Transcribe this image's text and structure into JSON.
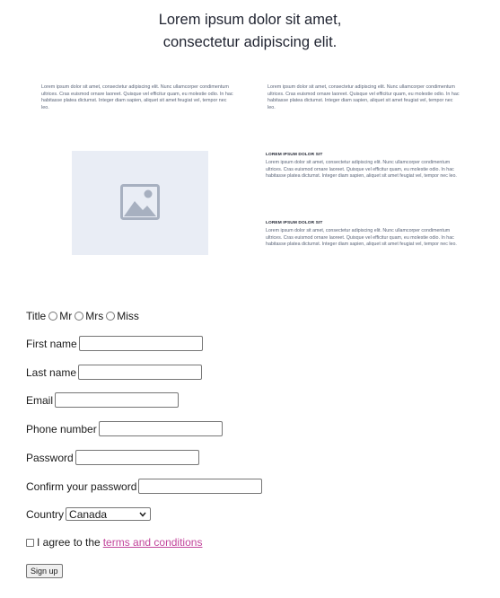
{
  "hero": {
    "headline_line1": "Lorem ipsum dolor sit amet,",
    "headline_line2": "consectetur adipiscing elit."
  },
  "content": {
    "para_left": "Lorem ipsum dolor sit amet, consectetur adipiscing elit. Nunc ullamcorper condimentum ultrices. Cras euismod ornare laoreet. Quisque vel efficitur quam, eu molestie odio. In hac habitasse platea dictumst. Integer diam sapien, aliquet sit amet feugiat vel, tempor nec leo.",
    "para_right": "Lorem ipsum dolor sit amet, consectetur adipiscing elit. Nunc ullamcorper condimentum ultrices. Cras euismod ornare laoreet. Quisque vel efficitur quam, eu molestie odio. In hac habitasse platea dictumst. Integer diam sapien, aliquet sit amet feugiat vel, tempor nec leo.",
    "image_icon": "image-placeholder-icon",
    "features": [
      {
        "title": "LOREM IPSUM DOLOR SIT",
        "text": "Lorem ipsum dolor sit amet, consectetur adipiscing elit. Nunc ullamcorper condimentum ultrices. Cras euismod ornare laoreet. Quisque vel efficitur quam, eu molestie odio. In hac habitasse platea dictumst. Integer diam sapien, aliquet sit amet feugiat vel, tempor nec leo."
      },
      {
        "title": "LOREM IPSUM DOLOR SIT",
        "text": "Lorem ipsum dolor sit amet, consectetur adipiscing elit. Nunc ullamcorper condimentum ultrices. Cras euismod ornare laoreet. Quisque vel efficitur quam, eu molestie odio. In hac habitasse platea dictumst. Integer diam sapien, aliquet sit amet feugiat vel, tempor nec leo."
      }
    ]
  },
  "form": {
    "title_label": "Title",
    "title_options": [
      "Mr",
      "Mrs",
      "Miss"
    ],
    "first_name_label": "First name",
    "first_name_value": "",
    "last_name_label": "Last name",
    "last_name_value": "",
    "email_label": "Email",
    "email_value": "",
    "phone_label": "Phone number",
    "phone_value": "",
    "password_label": "Password",
    "password_value": "",
    "confirm_label": "Confirm your password",
    "confirm_value": "",
    "country_label": "Country",
    "country_selected": "Canada",
    "agree_prefix": "I agree to the",
    "agree_link": "terms and conditions",
    "submit_label": "Sign up"
  },
  "colors": {
    "link": "#c2459b",
    "placeholder_bg": "#e9edf5",
    "placeholder_icon": "#a7b0c0"
  }
}
